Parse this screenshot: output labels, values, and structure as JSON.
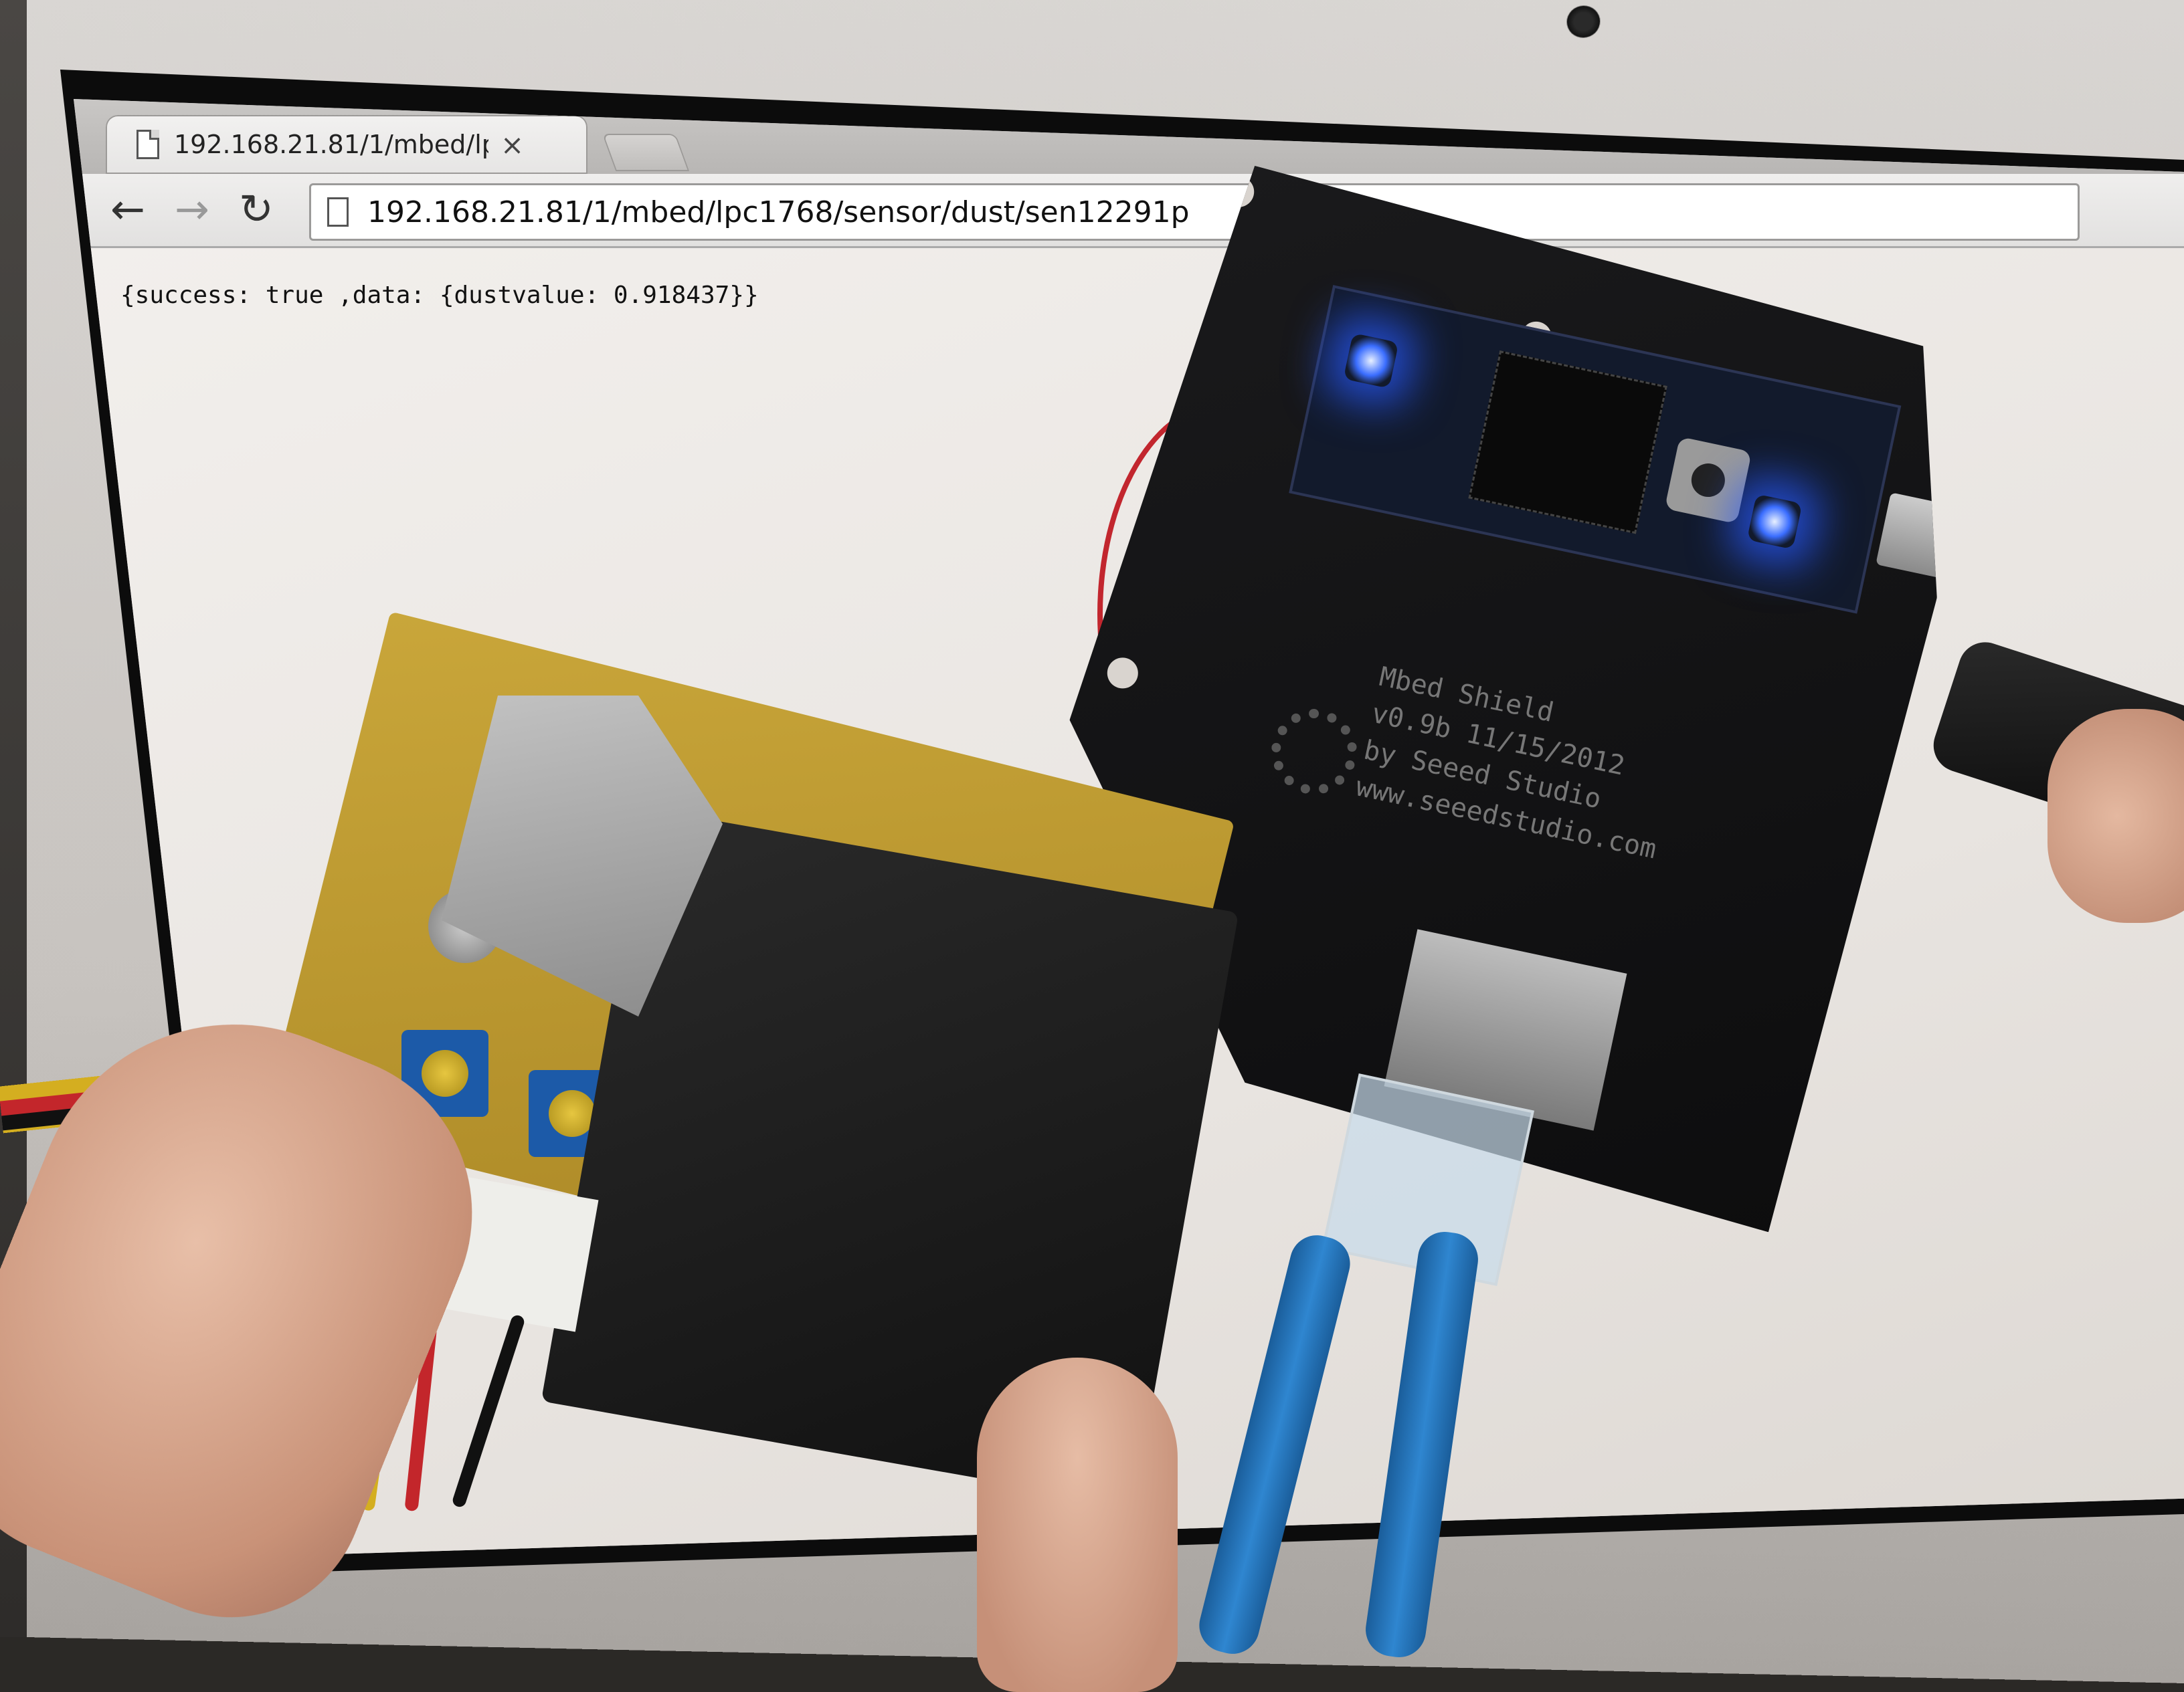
{
  "browser": {
    "tab_title": "192.168.21.81/1/mbed/lp",
    "tab_close_glyph": "×",
    "address_url": "192.168.21.81/1/mbed/lpc1768/sensor/dust/sen12291p",
    "nav": {
      "back_glyph": "←",
      "forward_glyph": "→",
      "reload_glyph": "↻"
    },
    "page_text": "{success: true ,data: {dustvalue: 0.918437}}"
  },
  "icons": {
    "tab_page_icon": "document-icon",
    "address_page_icon": "document-icon",
    "back": "back-arrow-icon",
    "forward": "forward-arrow-icon",
    "reload": "reload-icon",
    "close": "close-icon"
  },
  "scene": {
    "board_silkscreen": "Mbed Shield\nv0.9b 11/15/2012\nby Seeed Studio\nwww.seeedstudio.com",
    "led_color": "#3a6dff",
    "pcb_color": "#c9a63a",
    "ethernet_cable_color": "#2f86d0"
  }
}
